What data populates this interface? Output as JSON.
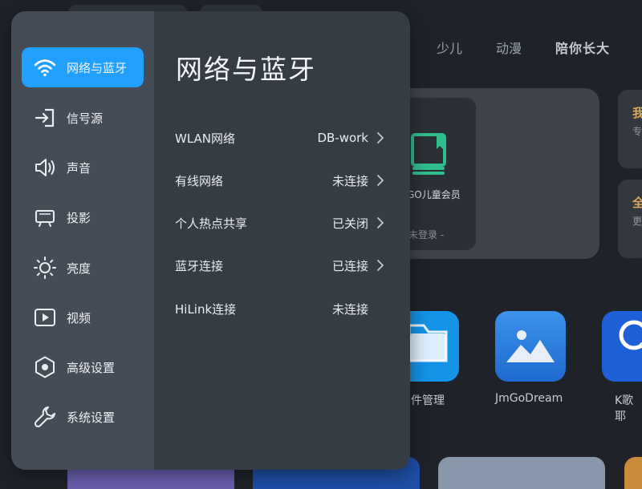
{
  "background": {
    "nav_tabs": [
      {
        "label": "少儿"
      },
      {
        "label": "动漫"
      },
      {
        "label": "陪你长大"
      }
    ],
    "banner": {
      "vip_label": "GO儿童会员",
      "login_status": "未登录 -"
    },
    "side_cards": [
      {
        "title": "我",
        "sub": "专"
      },
      {
        "title": "全",
        "sub": "更"
      }
    ],
    "apps": [
      {
        "label": "件管理",
        "icon": "folder-icon",
        "color": "#1593e6"
      },
      {
        "label": "JmGoDream",
        "icon": "image-icon",
        "color": "#2d7fe0"
      },
      {
        "label": "K歌耶",
        "icon": "microphone-icon",
        "color": "#1d5fd6"
      }
    ],
    "colors": {
      "accent": "#22a0ff",
      "vip_icon": "#2fbf8f"
    }
  },
  "sidebar": {
    "items": [
      {
        "label": "网络与蓝牙",
        "icon": "wifi-icon",
        "active": true
      },
      {
        "label": "信号源",
        "icon": "signal-source-icon",
        "active": false
      },
      {
        "label": "声音",
        "icon": "speaker-icon",
        "active": false
      },
      {
        "label": "投影",
        "icon": "projector-icon",
        "active": false
      },
      {
        "label": "亮度",
        "icon": "brightness-icon",
        "active": false
      },
      {
        "label": "视频",
        "icon": "video-icon",
        "active": false
      },
      {
        "label": "高级设置",
        "icon": "advanced-settings-icon",
        "active": false
      },
      {
        "label": "系统设置",
        "icon": "wrench-icon",
        "active": false
      }
    ]
  },
  "content": {
    "title": "网络与蓝牙",
    "rows": [
      {
        "label": "WLAN网络",
        "value": "DB-work",
        "chevron": true
      },
      {
        "label": "有线网络",
        "value": "未连接",
        "chevron": true
      },
      {
        "label": "个人热点共享",
        "value": "已关闭",
        "chevron": true
      },
      {
        "label": "蓝牙连接",
        "value": "已连接",
        "chevron": true
      },
      {
        "label": "HiLink连接",
        "value": "未连接",
        "chevron": false
      }
    ]
  }
}
